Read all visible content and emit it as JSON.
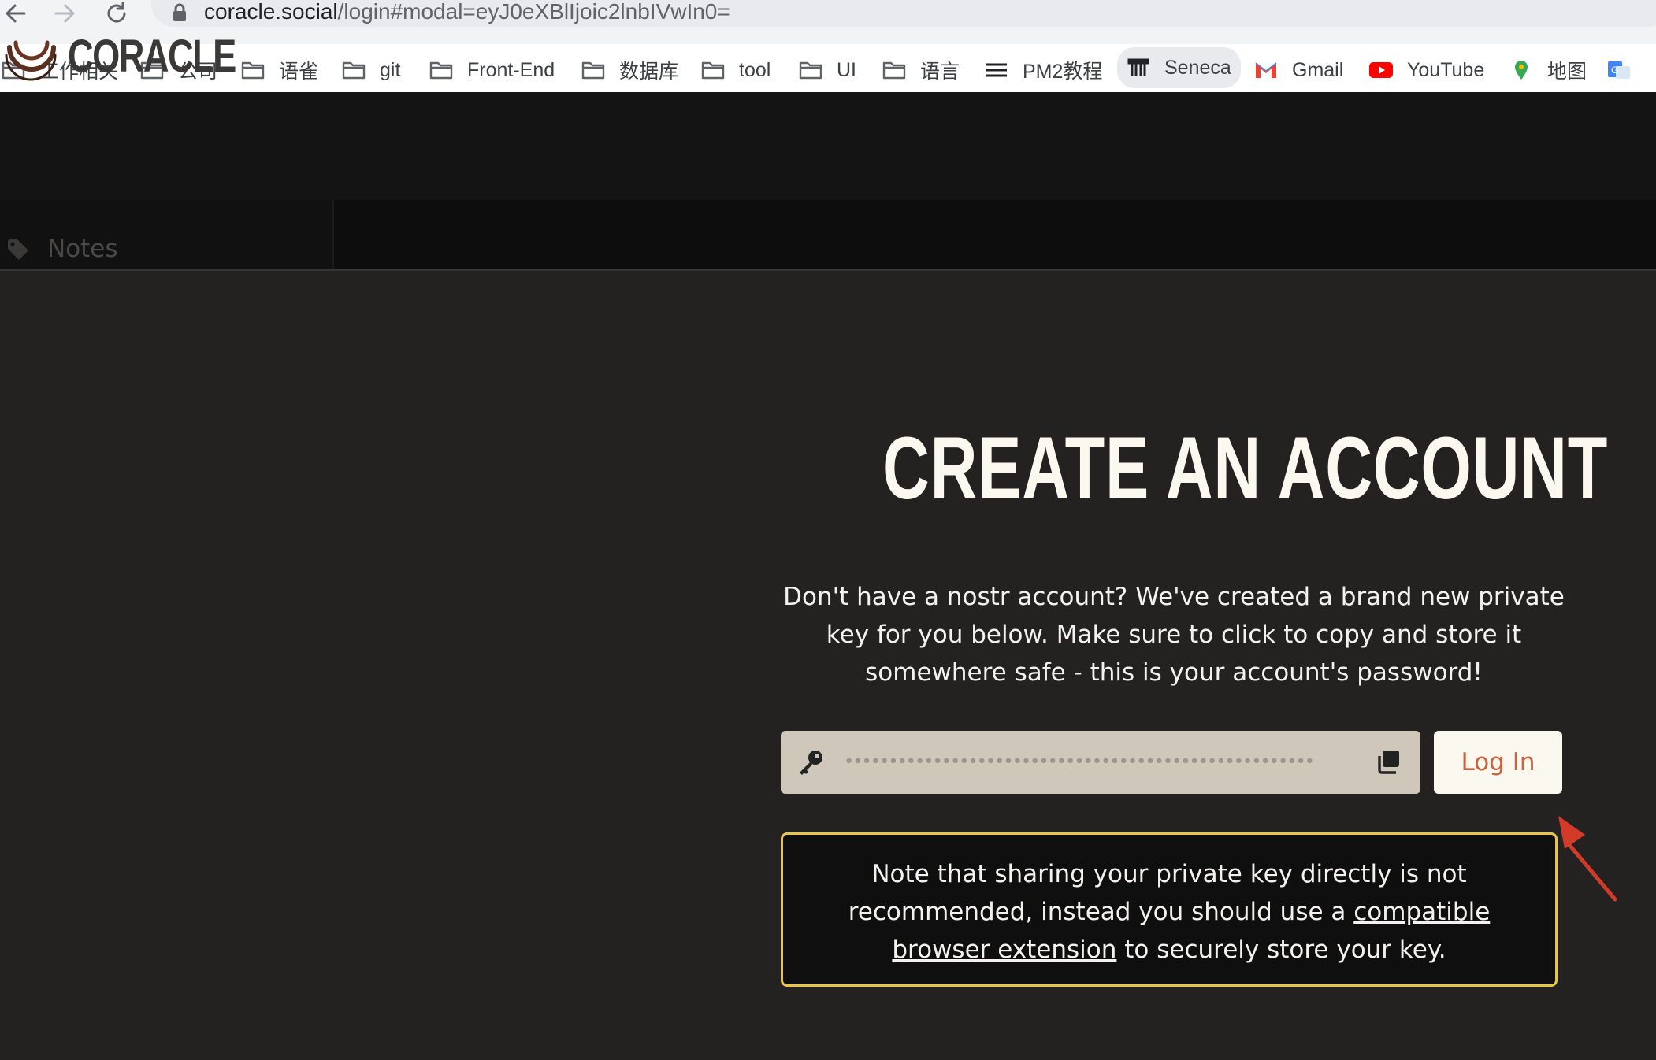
{
  "browser": {
    "url_host": "coracle.social",
    "url_path": "/login#modal=eyJ0eXBlIjoic2lnbIVwIn0=",
    "bookmarks": [
      {
        "label": "工作相关",
        "icon": "folder-icon"
      },
      {
        "label": "公司",
        "icon": "folder-icon"
      },
      {
        "label": "语雀",
        "icon": "folder-icon"
      },
      {
        "label": "git",
        "icon": "folder-icon"
      },
      {
        "label": "Front-End",
        "icon": "folder-icon"
      },
      {
        "label": "数据库",
        "icon": "folder-icon"
      },
      {
        "label": "tool",
        "icon": "folder-icon"
      },
      {
        "label": "UI",
        "icon": "folder-icon"
      },
      {
        "label": "语言",
        "icon": "folder-icon"
      },
      {
        "label": "PM2教程",
        "icon": "menu-lines-icon"
      },
      {
        "label": "Seneca",
        "icon": "column-icon"
      },
      {
        "label": "Gmail",
        "icon": "gmail-icon"
      },
      {
        "label": "YouTube",
        "icon": "youtube-icon"
      },
      {
        "label": "地图",
        "icon": "maps-pin-icon"
      }
    ]
  },
  "app": {
    "logo_text": "CORACLE",
    "sidebar_item": "Notes"
  },
  "signup": {
    "title": "CREATE AN ACCOUNT",
    "intro": "Don't have a nostr account? We've created a brand new private key for you below. Make sure to click to copy and store it somewhere safe - this is your account's password!",
    "private_key_masked": "••••••••••••••••••••••••••••••••••••••••••••••••••••••••••••••••",
    "login_label": "Log In",
    "notice_pre": "Note that sharing your private key directly is not recommended, instead you should use a ",
    "notice_link": "compatible browser extension",
    "notice_post": " to securely store your key."
  },
  "colors": {
    "background": "#232221",
    "nav": "#151414",
    "accent": "#c8633f",
    "notice_border": "#e6c54a",
    "annotation_arrow": "#d43a2a"
  }
}
